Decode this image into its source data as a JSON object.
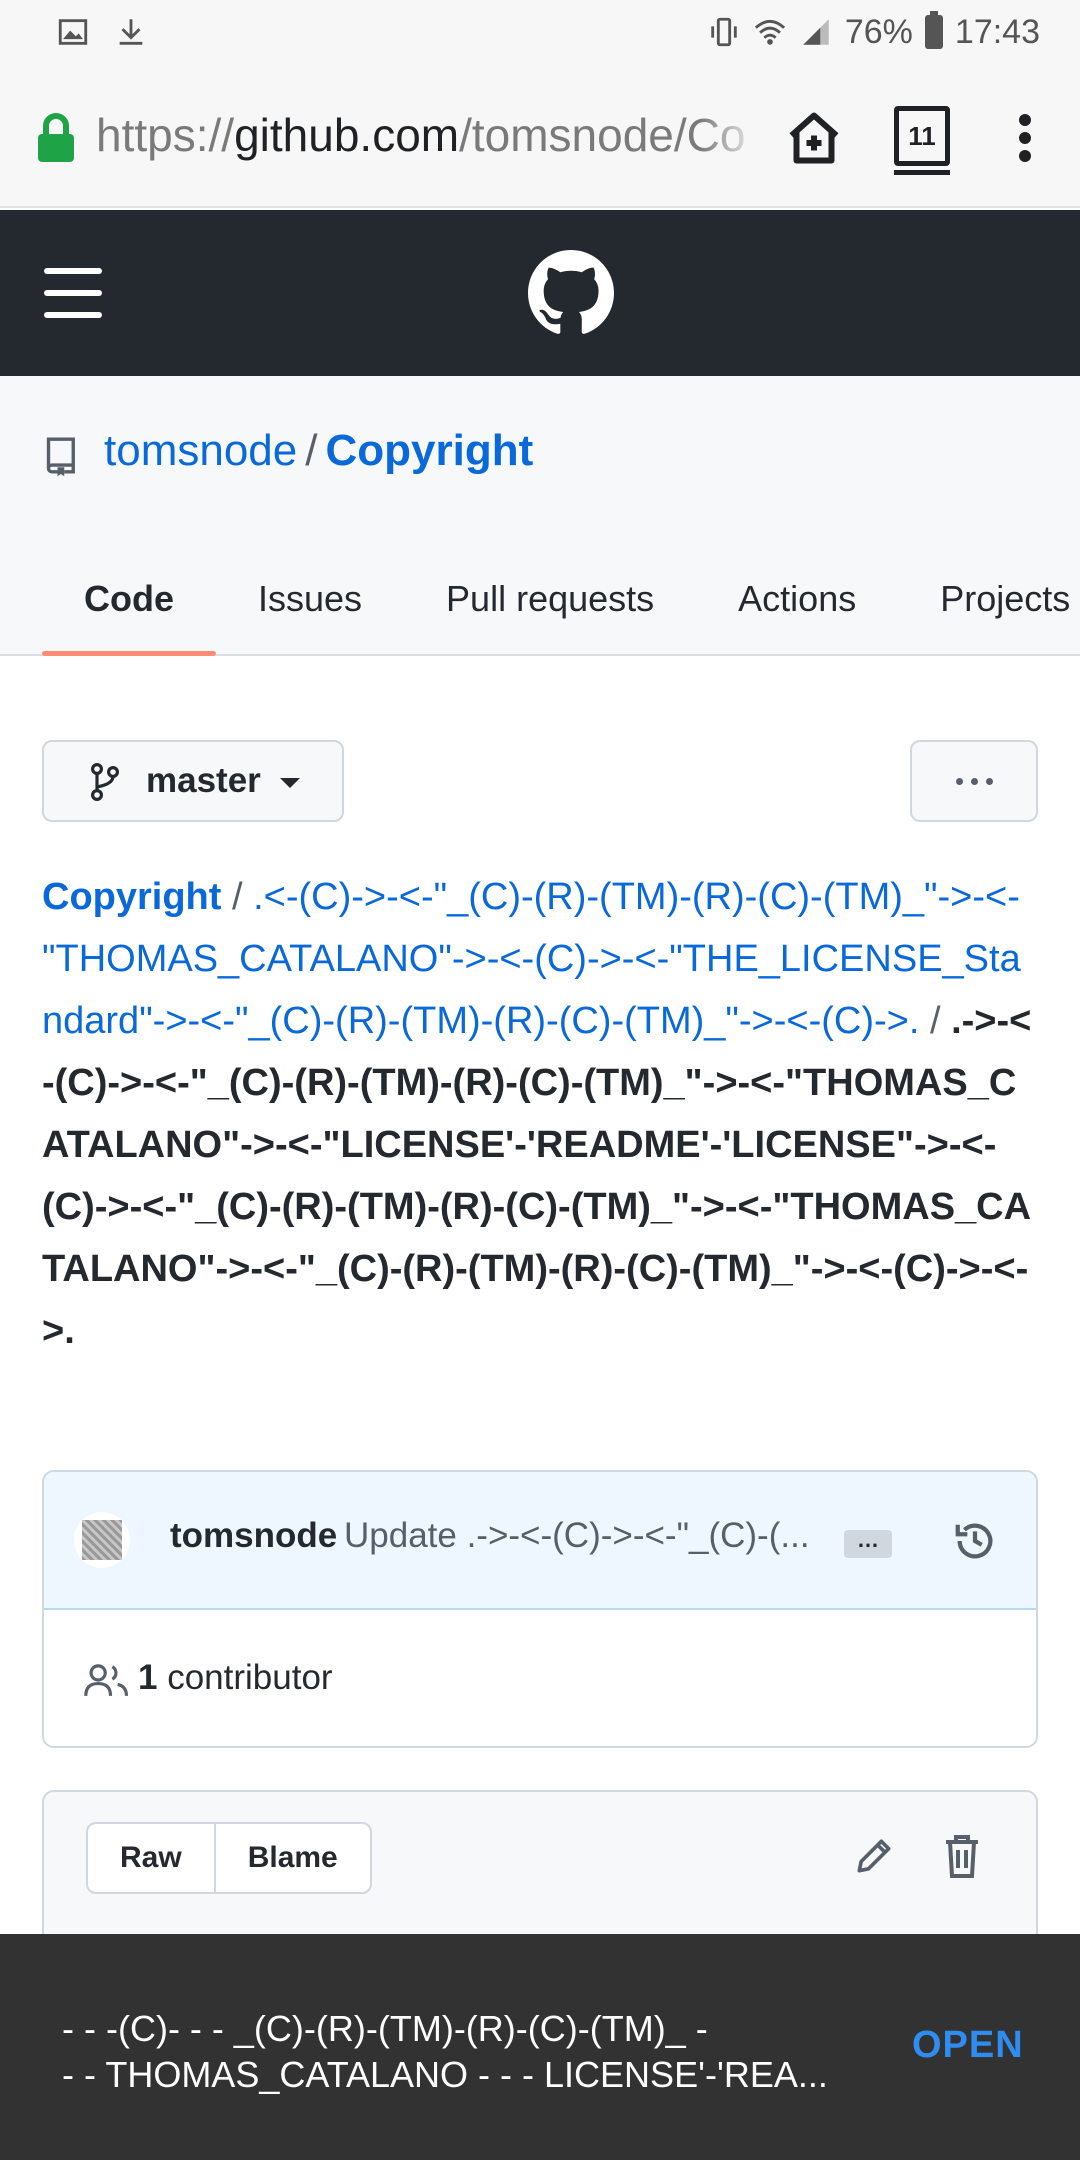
{
  "status_bar": {
    "battery": "76%",
    "time": "17:43"
  },
  "browser": {
    "url_scheme": "https://",
    "url_host": "github.com",
    "url_path": "/tomsnode/Co",
    "tab_count": "11"
  },
  "repo": {
    "owner": "tomsnode",
    "separator": "/",
    "name": "Copyright"
  },
  "nav_tabs": [
    {
      "label": "Code"
    },
    {
      "label": "Issues"
    },
    {
      "label": "Pull requests"
    },
    {
      "label": "Actions"
    },
    {
      "label": "Projects"
    }
  ],
  "branch": {
    "label": "master"
  },
  "breadcrumb": {
    "repo": "Copyright",
    "slash": "/",
    "dir": ".<-(C)->-<-\"_(C)-(R)-(TM)-(R)-(C)-(TM)_\"->-<-\"THOMAS_CATALANO\"->-<-(C)->-<-\"THE_LICENSE_Standard\"->-<-\"_(C)-(R)-(TM)-(R)-(C)-(TM)_\"->-<-(C)->.",
    "file": ".->-<-(C)->-<-\"_(C)-(R)-(TM)-(R)-(C)-(TM)_\"->-<-\"THOMAS_CATALANO\"->-<-\"LICENSE'-'README'-'LICENSE\"->-<-(C)->-<-\"_(C)-(R)-(TM)-(R)-(C)-(TM)_\"->-<-\"THOMAS_CATALANO\"->-<-\"_(C)-(R)-(TM)-(R)-(C)-(TM)_\"->-<-(C)->-<->."
  },
  "commit": {
    "author": "tomsnode",
    "message": "Update .->-<-(C)->-<-\"_(C)-(...",
    "ellipsis": "…"
  },
  "contributors": {
    "count": "1",
    "label": "contributor"
  },
  "file_actions": {
    "raw": "Raw",
    "blame": "Blame"
  },
  "snackbar": {
    "line1": "- - -(C)- - - _(C)-(R)-(TM)-(R)-(C)-(TM)_ -",
    "line2": "- - THOMAS_CATALANO - - - LICENSE'-'REA...",
    "action": "OPEN"
  },
  "colors": {
    "link": "#0969da",
    "header_bg": "#24292f",
    "active_tab_underline": "#fd8c73",
    "snackbar_bg": "#323232",
    "snackbar_action": "#2f8df2"
  },
  "icons": [
    "image-icon",
    "download-icon",
    "vibrate-icon",
    "wifi-icon",
    "signal-icon",
    "battery-icon",
    "lock-icon",
    "home-icon",
    "tabs-icon",
    "overflow-menu-icon",
    "hamburger-icon",
    "github-logo-icon",
    "repo-icon",
    "branch-icon",
    "chevron-down-icon",
    "more-icon",
    "history-icon",
    "people-icon",
    "pencil-icon",
    "trash-icon"
  ]
}
